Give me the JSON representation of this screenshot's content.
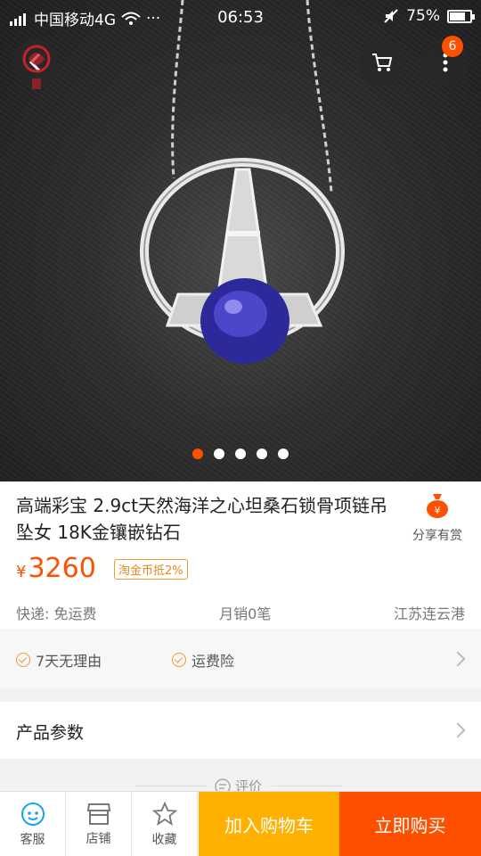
{
  "status_bar": {
    "carrier": "中国移动4G",
    "time": "06:53",
    "battery": "75%",
    "battery_level": 0.75
  },
  "header": {
    "cart_badge": "6"
  },
  "carousel": {
    "count": 5,
    "active_index": 0
  },
  "product": {
    "title": "高端彩宝 2.9ct天然海洋之心坦桑石锁骨项链吊坠女 18K金镶嵌钻石",
    "share_label": "分享有赏",
    "currency": "¥",
    "price": "3260",
    "coin_tag": "淘金币抵2%",
    "shipping": "快递: 免运费",
    "monthly_sales": "月销0笔",
    "location": "江苏连云港"
  },
  "services": [
    {
      "label": "7天无理由"
    },
    {
      "label": "运费险"
    }
  ],
  "params": {
    "label": "产品参数"
  },
  "reviews": {
    "label": "评价"
  },
  "bottom_bar": {
    "service_label": "客服",
    "shop_label": "店铺",
    "favorite_label": "收藏",
    "add_to_cart_label": "加入购物车",
    "buy_now_label": "立即购买"
  },
  "colors": {
    "accent": "#ff5000",
    "cart_button": "#ffb000",
    "coin_tag": "#f29a2e"
  }
}
